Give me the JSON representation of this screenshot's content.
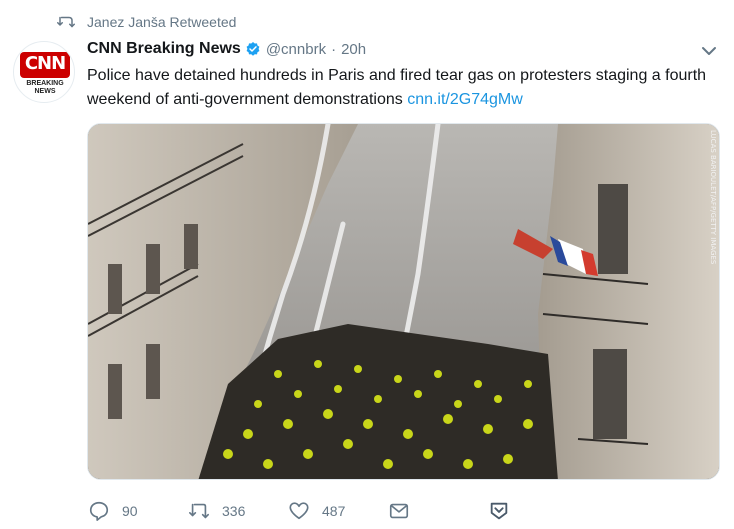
{
  "retweet_context": {
    "text": "Janez Janša Retweeted",
    "icon": "retweet-icon"
  },
  "tweet": {
    "author_name": "CNN Breaking News",
    "handle": "@cnnbrk",
    "separator": "·",
    "time": "20h",
    "avatar": {
      "logo_text": "CNN",
      "sub_line1": "BREAKING",
      "sub_line2": "NEWS"
    },
    "text": "Police have detained hundreds in Paris and fired tear gas on protesters staging a fourth weekend of anti-government demonstrations ",
    "link": "cnn.it/2G74gMw",
    "media": {
      "description_icon": "photo",
      "credit": "LUCAS BARIOULET/AFP/GETTY IMAGES"
    }
  },
  "actions": {
    "reply_count": "90",
    "retweet_count": "336",
    "like_count": "487",
    "icons": [
      "reply-icon",
      "retweet-icon",
      "like-icon",
      "message-icon",
      "bookmark-icon"
    ]
  },
  "colors": {
    "link": "#1b95e0",
    "muted": "#657786",
    "verified": "#1da1f2",
    "cnn_red": "#cc0000"
  }
}
